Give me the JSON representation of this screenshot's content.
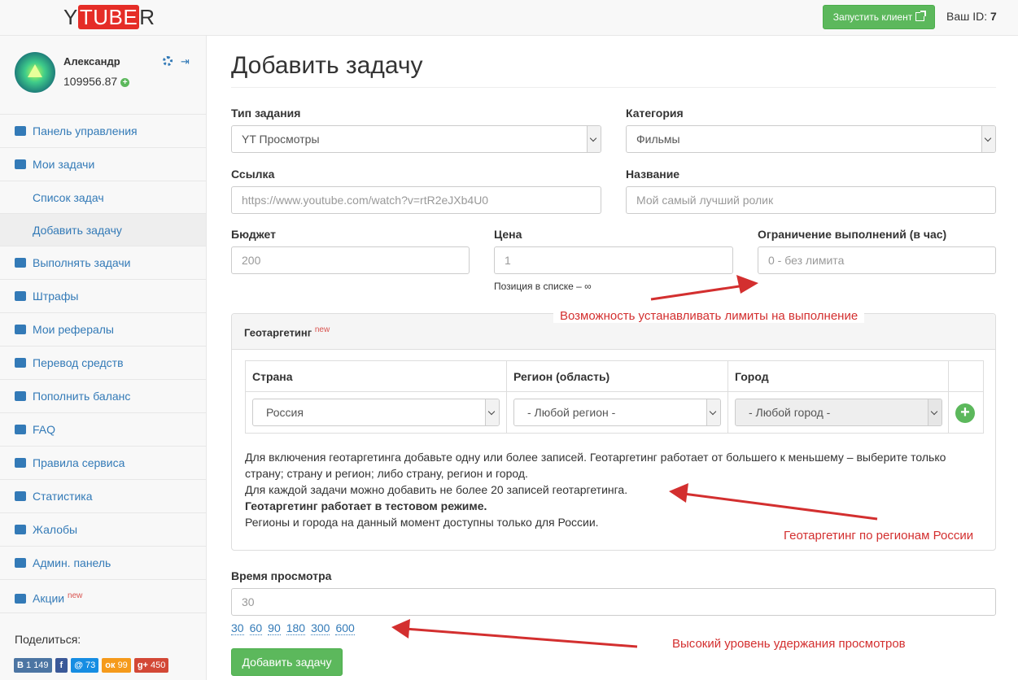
{
  "header": {
    "logo_prefix": "Y",
    "logo_mid": "TUBE",
    "logo_suffix": "R",
    "launch_label": "Запустить клиент",
    "id_label": "Ваш ID:",
    "id_value": "7"
  },
  "user": {
    "name": "Александр",
    "balance": "109956.87"
  },
  "sidebar": {
    "items": [
      {
        "label": "Панель управления",
        "icon": "dashboard-icon"
      },
      {
        "label": "Мои задачи",
        "icon": "video-camera-icon"
      },
      {
        "label": "Список задач"
      },
      {
        "label": "Добавить задачу"
      },
      {
        "label": "Выполнять задачи",
        "icon": "eye-icon"
      },
      {
        "label": "Штрафы",
        "icon": "exclamation-icon"
      },
      {
        "label": "Мои рефералы",
        "icon": "users-icon"
      },
      {
        "label": "Перевод средств",
        "icon": "exchange-icon"
      },
      {
        "label": "Пополнить баланс",
        "icon": "ruble-icon"
      },
      {
        "label": "FAQ",
        "icon": "lifebuoy-icon"
      },
      {
        "label": "Правила сервиса",
        "icon": "book-icon"
      },
      {
        "label": "Статистика",
        "icon": "bar-chart-icon"
      },
      {
        "label": "Жалобы",
        "icon": "gavel-icon"
      },
      {
        "label": "Админ. панель",
        "icon": "wrench-icon"
      },
      {
        "label": "Акции",
        "icon": "bullhorn-icon",
        "badge": "new"
      }
    ],
    "share_label": "Поделиться:",
    "share": [
      {
        "label": "В",
        "count": "1 149",
        "color": "#4c75a3"
      },
      {
        "label": "f",
        "count": "",
        "color": "#3b5998"
      },
      {
        "label": "@",
        "count": "73",
        "color": "#168de2"
      },
      {
        "label": "ок",
        "count": "99",
        "color": "#f59a1b"
      },
      {
        "label": "g+",
        "count": "450",
        "color": "#d34836"
      }
    ]
  },
  "form": {
    "title": "Добавить задачу",
    "task_type_label": "Тип задания",
    "task_type_value": "YT Просмотры",
    "category_label": "Категория",
    "category_value": "Фильмы",
    "link_label": "Ссылка",
    "link_placeholder": "https://www.youtube.com/watch?v=rtR2eJXb4U0",
    "name_label": "Название",
    "name_placeholder": "Мой самый лучший ролик",
    "budget_label": "Бюджет",
    "budget_placeholder": "200",
    "price_label": "Цена",
    "price_placeholder": "1",
    "price_help": "Позиция в списке – ∞",
    "limit_label": "Ограничение выполнений (в час)",
    "limit_placeholder": "0 - без лимита",
    "watch_time_label": "Время просмотра",
    "watch_time_placeholder": "30",
    "quick_times": [
      "30",
      "60",
      "90",
      "180",
      "300",
      "600"
    ],
    "submit_label": "Добавить задачу"
  },
  "geo": {
    "title": "Геотаргетинг",
    "badge": "new",
    "col_country": "Страна",
    "col_region": "Регион (область)",
    "col_city": "Город",
    "country_value": "Россия",
    "region_value": "- Любой регион -",
    "city_value": "- Любой город -",
    "text_line1": "Для включения геотаргетинга добавьте одну или более записей. Геотаргетинг работает от большего к меньшему – выберите только страну; страну и регион; либо страну, регион и город.",
    "text_line2": "Для каждой задачи можно добавить не более 20 записей геотаргетинга.",
    "text_line3": "Геотаргетинг работает в тестовом режиме.",
    "text_line4": "Регионы и города на данный момент доступны только для России."
  },
  "annotations": {
    "limits": "Возможность устанавливать лимиты на выполнение",
    "geo": "Геотаргетинг по регионам России",
    "retention": "Высокий уровень удержания просмотров",
    "color": "#d32f2f"
  }
}
